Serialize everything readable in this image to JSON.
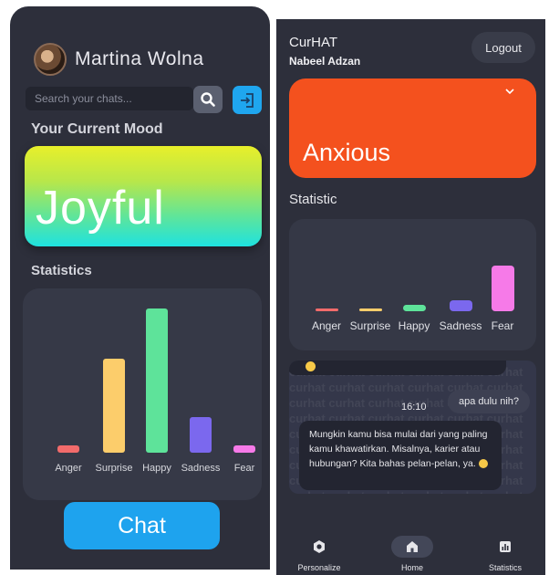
{
  "left_app": {
    "user_name": "Martina Wolna",
    "search_placeholder": "Search your chats...",
    "mood_title": "Your Current Mood",
    "mood": "Joyful",
    "stats_title": "Statistics",
    "stats": [
      {
        "label": "Anger",
        "value": 0.05,
        "color": "#f26b6b"
      },
      {
        "label": "Surprise",
        "value": 0.65,
        "color": "#fccd6b"
      },
      {
        "label": "Happy",
        "value": 1.0,
        "color": "#5ee39a"
      },
      {
        "label": "Sadness",
        "value": 0.25,
        "color": "#7b68ee"
      },
      {
        "label": "Fear",
        "value": 0.05,
        "color": "#f67ae8"
      }
    ],
    "chat_button": "Chat"
  },
  "right_app": {
    "app_title": "CurHAT",
    "user_name": "Nabeel Adzan",
    "logout_label": "Logout",
    "mood": "Anxious",
    "stats_title": "Statistic",
    "stats": [
      {
        "label": "Anger",
        "value": 0.03,
        "color": "#f26b6b"
      },
      {
        "label": "Surprise",
        "value": 0.06,
        "color": "#fccd6b"
      },
      {
        "label": "Happy",
        "value": 0.15,
        "color": "#5ee39a"
      },
      {
        "label": "Sadness",
        "value": 0.25,
        "color": "#7b68ee"
      },
      {
        "label": "Fear",
        "value": 1.0,
        "color": "#f67ae8"
      }
    ],
    "chat": {
      "pattern_text": "curhat curhat curhat curhat curhat curhat",
      "time": "16:10",
      "user_message": "apa dulu nih?",
      "bot_message": "Mungkin kamu bisa mulai dari yang paling kamu khawatirkan. Misalnya, karier atau hubungan? Kita bahas pelan-pelan, ya."
    },
    "nav": [
      {
        "label": "Personalize",
        "icon": "settings-icon"
      },
      {
        "label": "Home",
        "icon": "home-icon"
      },
      {
        "label": "Statistics",
        "icon": "statistics-icon"
      }
    ]
  }
}
